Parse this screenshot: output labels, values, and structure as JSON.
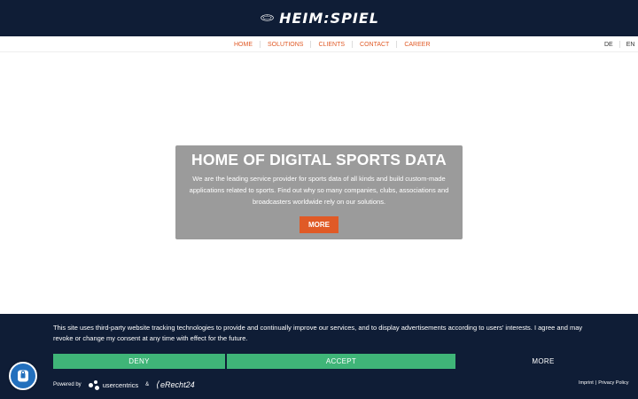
{
  "header": {
    "logo_text": "HEIM:SPIEL",
    "logo_icon": "stadium-icon"
  },
  "nav": {
    "items": [
      "HOME",
      "SOLUTIONS",
      "CLIENTS",
      "CONTACT",
      "CAREER"
    ],
    "languages": [
      "DE",
      "EN"
    ]
  },
  "hero": {
    "title": "HOME OF DIGITAL SPORTS DATA",
    "lines": [
      "We are the leading service provider for sports data of all kinds and build custom-made",
      "applications related to sports. Find out why so many companies, clubs, associations and",
      "broadcasters worldwide rely on our solutions."
    ],
    "button_label": "MORE"
  },
  "consent": {
    "lines": [
      "This site uses third-party website tracking technologies to provide and continually improve our services, and to display advertisements according to users' interests. I agree and may",
      "revoke or change my consent at any time with effect for the future."
    ],
    "deny_label": "DENY",
    "accept_label": "ACCEPT",
    "more_label": "MORE",
    "powered_by": "Powered by",
    "usercentrics": "usercentrics",
    "ampersand": "&",
    "erecht": "eRecht24",
    "imprint": "Imprint",
    "separator": "|",
    "privacy": "Privacy Policy"
  },
  "colors": {
    "navy": "#0f1d36",
    "accent_orange": "#e05a26",
    "accept_green": "#3fb578",
    "hero_grey": "#9b9b9b",
    "chat_blue": "#2370bd"
  },
  "fab": {
    "icon": "consent-settings-icon"
  }
}
